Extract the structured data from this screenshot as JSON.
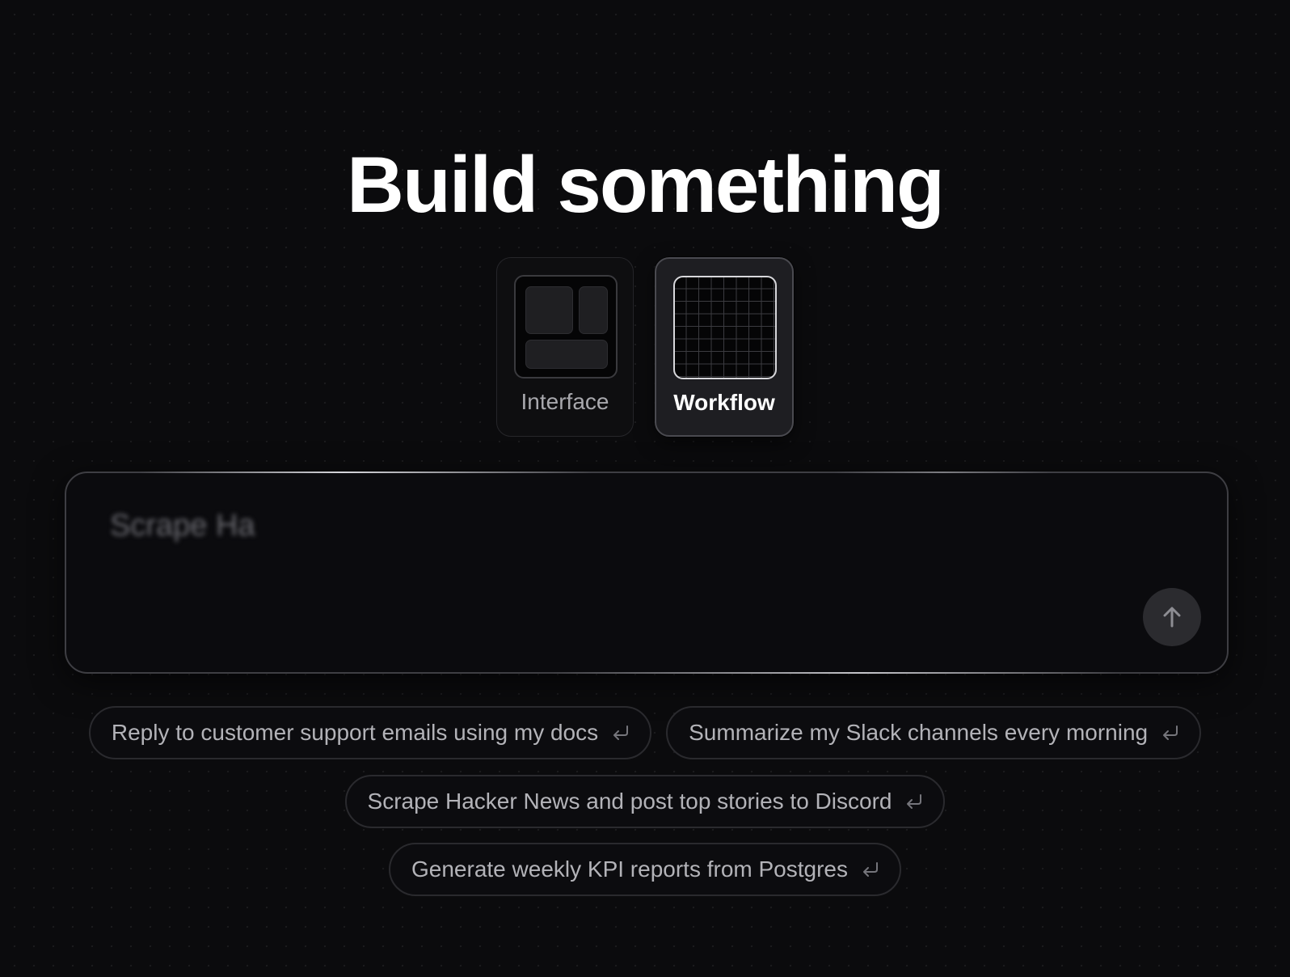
{
  "header": {
    "title": "Build something"
  },
  "modes": [
    {
      "id": "interface",
      "label": "Interface",
      "selected": false,
      "icon": "layout-icon"
    },
    {
      "id": "workflow",
      "label": "Workflow",
      "selected": true,
      "icon": "grid-icon"
    }
  ],
  "prompt": {
    "value": "Scrape Ha",
    "placeholder": "",
    "send_icon": "arrow-up-icon"
  },
  "suggestions": [
    {
      "label": "Reply to customer support emails using my docs",
      "icon": "enter-icon"
    },
    {
      "label": "Summarize my Slack channels every morning",
      "icon": "enter-icon"
    },
    {
      "label": "Scrape Hacker News and post top stories to Discord",
      "icon": "enter-icon"
    },
    {
      "label": "Generate weekly KPI reports from Postgres",
      "icon": "enter-icon"
    }
  ],
  "colors": {
    "background": "#0b0b0d",
    "title": "#ffffff",
    "chip_text": "#b3b3b8",
    "selected_card": "#1e1e22"
  }
}
